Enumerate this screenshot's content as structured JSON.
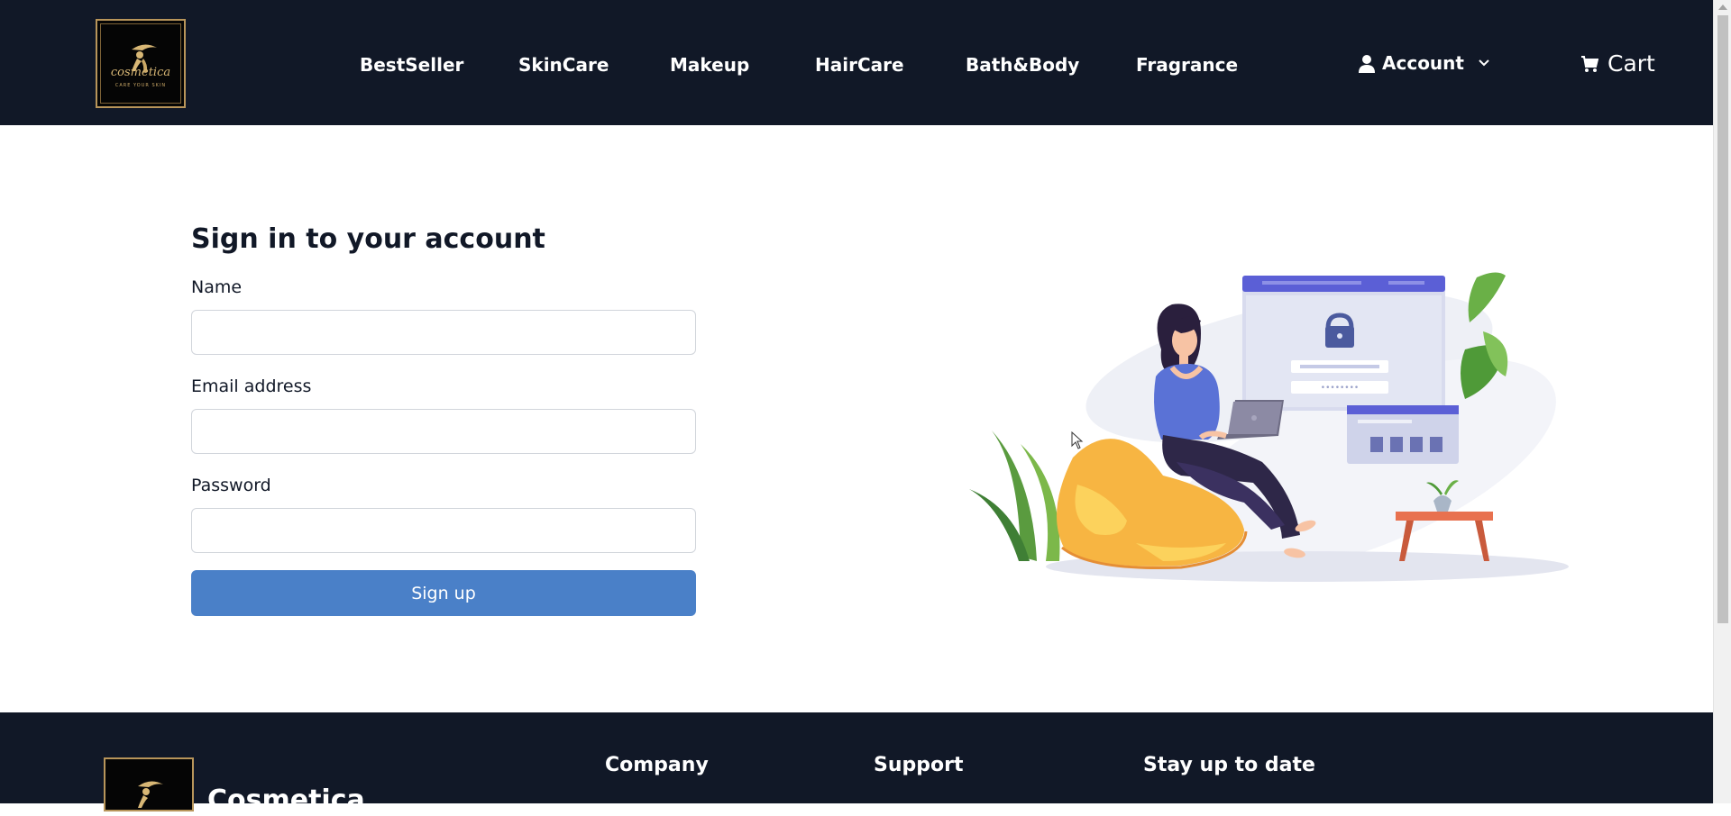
{
  "header": {
    "logo": {
      "script_text": "cosmetica",
      "tagline": "CARE YOUR SKIN"
    },
    "nav": [
      "BestSeller",
      "SkinCare",
      "Makeup",
      "HairCare",
      "Bath&Body",
      "Fragrance"
    ],
    "account_label": "Account",
    "cart_label": "Cart"
  },
  "form": {
    "title": "Sign in to your account",
    "name_label": "Name",
    "name_value": "",
    "email_label": "Email address",
    "email_value": "",
    "password_label": "Password",
    "password_value": "",
    "submit_label": "Sign up"
  },
  "illustration": {
    "password_mask": "••••••••"
  },
  "footer": {
    "brand": "Cosmetica",
    "columns": [
      "Company",
      "Support",
      "Stay up to date"
    ]
  },
  "colors": {
    "header_bg": "#111827",
    "button_bg": "#4a80c8",
    "accent_gold": "#b8955a",
    "illustration_purple": "#5b5fd6"
  },
  "icons": [
    "logo-image",
    "user-icon",
    "chevron-down-icon",
    "cart-icon",
    "lock-icon",
    "mouse-cursor-icon"
  ]
}
